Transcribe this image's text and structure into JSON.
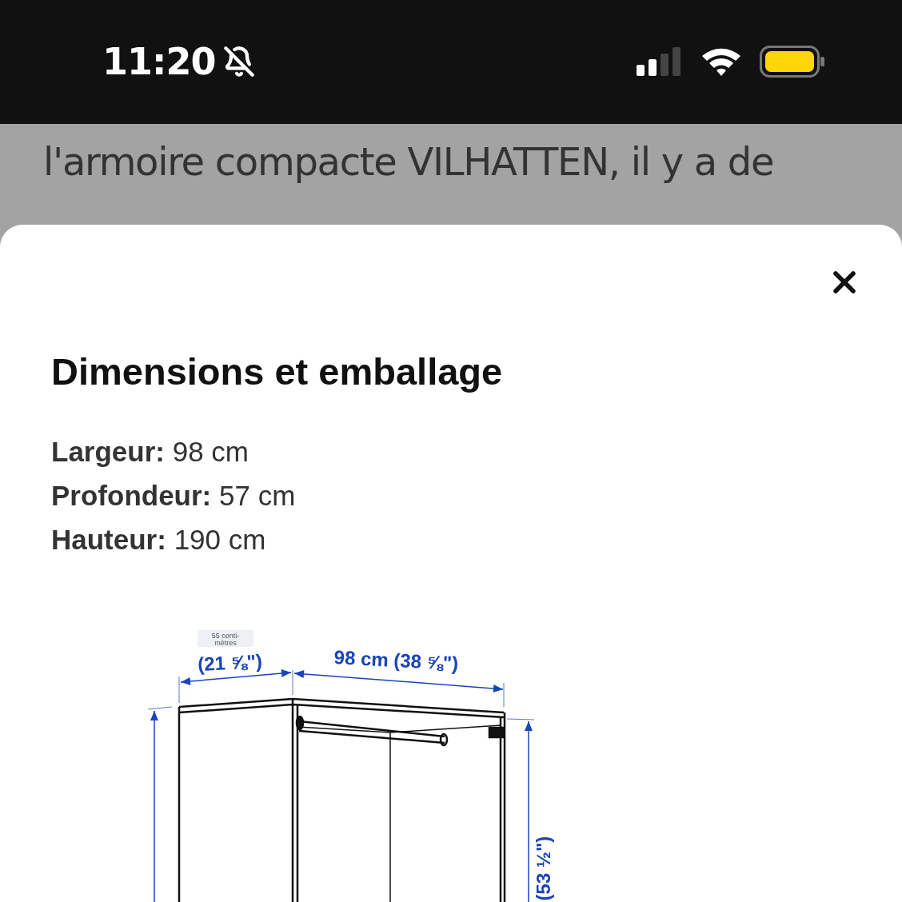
{
  "status_bar": {
    "time": "11:20"
  },
  "background_text": [
    "l'armoire compacte VILHATTEN, il y a de"
  ],
  "sheet": {
    "title": "Dimensions et emballage",
    "specs": [
      {
        "label": "Largeur:",
        "value": "98 cm"
      },
      {
        "label": "Profondeur:",
        "value": "57 cm"
      },
      {
        "label": "Hauteur:",
        "value": "190 cm"
      }
    ],
    "diagram": {
      "unit_tag": [
        "55 centi-",
        "mètres"
      ],
      "depth_label": "(21 ⅝\")",
      "width_label": "98 cm (38 ⅝\")",
      "height_label": "(53 ½\")"
    }
  }
}
